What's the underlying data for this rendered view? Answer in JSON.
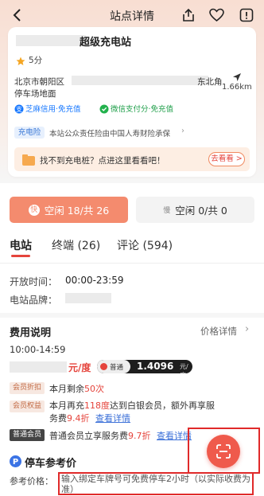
{
  "header": {
    "title": "站点详情"
  },
  "station": {
    "name": "超级充电站",
    "rating": "5分",
    "address_line1_start": "北京市朝阳区",
    "address_line1_end": "东北角",
    "address_line2": "停车场地面",
    "distance": "1.66km",
    "pay_methods": [
      "芝麻信用·免充值",
      "微信支付分·免充值"
    ],
    "insurance_tag": "充电险",
    "insurance_text": "本站公众责任险由中国人寿财险承保",
    "find_text": "找不到充电桩？点进这里看看吧！",
    "find_button": "去看看 >"
  },
  "availability": {
    "fast": "空闲 18/共 26",
    "slow": "空闲 0/共 0"
  },
  "tabs": [
    "电站",
    "终端 (26)",
    "评论 (594)"
  ],
  "info": {
    "open_label": "开放时间：",
    "open_value": "00:00-23:59",
    "brand_label": "电站品牌："
  },
  "fee": {
    "title": "费用说明",
    "detail_link": "价格详情",
    "time_range": "10:00-14:59",
    "unit": "元/度",
    "member_type": "普通",
    "member_price": "1.4096",
    "member_unit": "元/度",
    "perks": [
      {
        "tag": "会员折扣",
        "text_pre": "本月剩余",
        "highlight": "50次",
        "text_post": ""
      },
      {
        "tag": "会员权益",
        "text_pre": "本月再充",
        "highlight": "118度",
        "text_post": "达到白银会员，额外再享服务费",
        "highlight2": "9.4折",
        "link": "查看详情"
      },
      {
        "tag": "普通会员",
        "text_pre": "普通会员立享服务费",
        "highlight": "9.7折",
        "link": "查看详情"
      }
    ]
  },
  "parking": {
    "title": "停车参考价",
    "label": "参考价格：",
    "text": "输入绑定车牌号可免费停车2小时（以实际收费为准）"
  },
  "colors": {
    "accent": "#e5443c",
    "fast_btn": "#f48b6e",
    "star": "#f5a623"
  }
}
